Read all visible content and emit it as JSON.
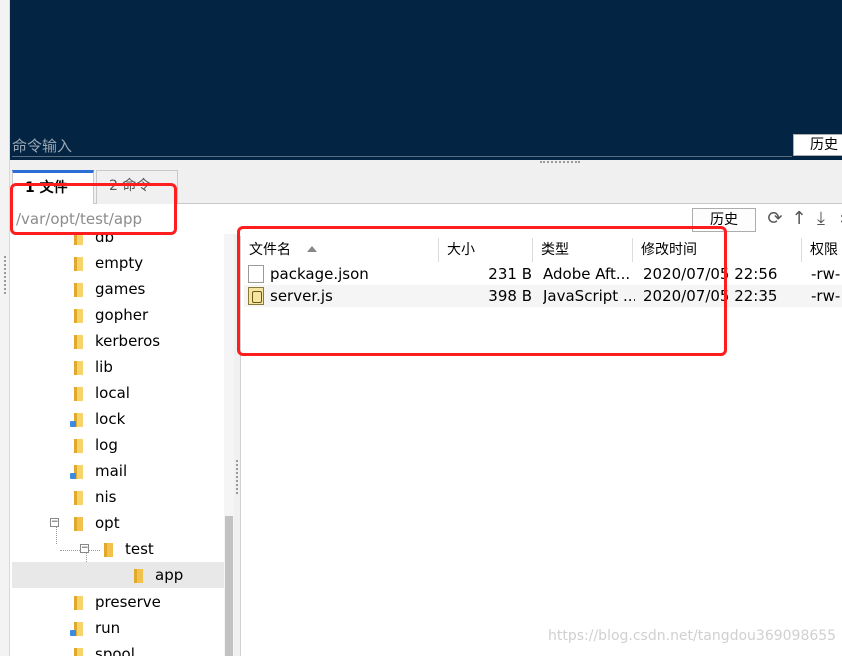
{
  "terminal": {
    "command_placeholder": "命令输入",
    "history_label": "历史"
  },
  "tabs": [
    {
      "label": "1 文件",
      "active": true
    },
    {
      "label": "2 命令",
      "active": false
    }
  ],
  "path_bar": {
    "path": "/var/opt/test/app",
    "history_label": "历史",
    "tool_icons": [
      "refresh-icon",
      "upload-icon",
      "download-icon",
      "more-icon"
    ]
  },
  "tree": {
    "items": [
      {
        "label": "db",
        "level": 0
      },
      {
        "label": "empty",
        "level": 0
      },
      {
        "label": "games",
        "level": 0
      },
      {
        "label": "gopher",
        "level": 0
      },
      {
        "label": "kerberos",
        "level": 0
      },
      {
        "label": "lib",
        "level": 0
      },
      {
        "label": "local",
        "level": 0
      },
      {
        "label": "lock",
        "level": 0,
        "symlink": true
      },
      {
        "label": "log",
        "level": 0
      },
      {
        "label": "mail",
        "level": 0,
        "symlink": true
      },
      {
        "label": "nis",
        "level": 0
      },
      {
        "label": "opt",
        "level": 0,
        "expanded": true
      },
      {
        "label": "test",
        "level": 1,
        "expanded": true
      },
      {
        "label": "app",
        "level": 2,
        "selected": true
      },
      {
        "label": "preserve",
        "level": 0
      },
      {
        "label": "run",
        "level": 0,
        "symlink": true
      },
      {
        "label": "spool",
        "level": 0
      }
    ]
  },
  "file_list": {
    "columns": [
      "文件名",
      "大小",
      "类型",
      "修改时间",
      "权限"
    ],
    "rows": [
      {
        "name": "package.json",
        "size": "231 B",
        "type": "Adobe Aft...",
        "modified": "2020/07/05 22:56",
        "perms": "-rw-",
        "icon": "file-icon"
      },
      {
        "name": "server.js",
        "size": "398 B",
        "type": "JavaScript ...",
        "modified": "2020/07/05 22:35",
        "perms": "-rw-",
        "icon": "js-file-icon"
      }
    ]
  },
  "watermark": "https://blog.csdn.net/tangdou369098655",
  "colors": {
    "terminal_bg": "#032442",
    "annotation": "#ff1e1e",
    "active_tab_accent": "#2b6fd6"
  }
}
